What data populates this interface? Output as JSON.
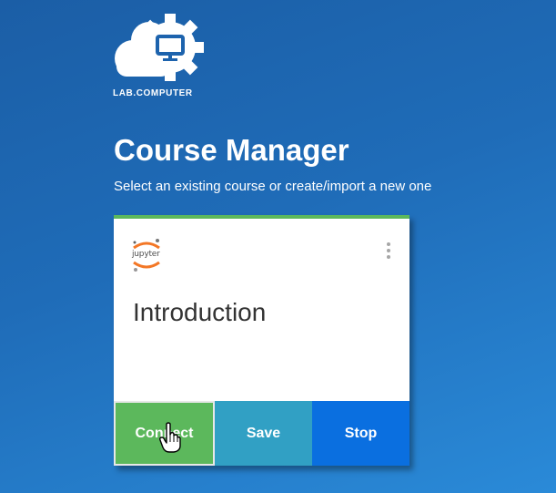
{
  "brand": {
    "name": "LAB.COMPUTER"
  },
  "header": {
    "title": "Course Manager",
    "subtitle": "Select an existing course or create/import a new one"
  },
  "course_card": {
    "kernel_logo_text": "jupyter",
    "course_name": "Introduction",
    "accent_color": "#5cb85c",
    "actions": {
      "connect_label": "Connect",
      "save_label": "Save",
      "stop_label": "Stop"
    },
    "colors": {
      "connect": "#5cb85c",
      "save": "#31a0c4",
      "stop": "#0a6fe0"
    }
  },
  "icons": {
    "logo": "cloud-gear-monitor-icon",
    "menu": "vertical-dots-icon",
    "cursor": "hand-pointer-icon"
  }
}
